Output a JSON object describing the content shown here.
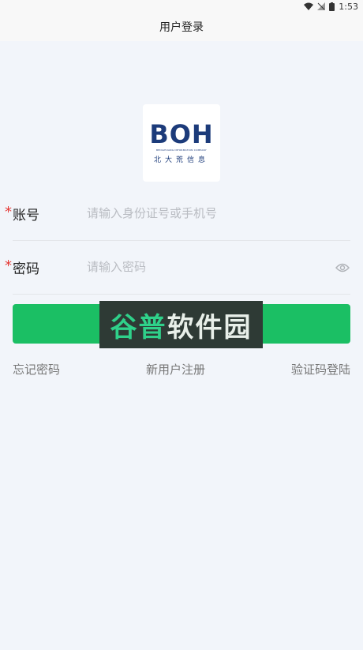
{
  "status_bar": {
    "time": "1:53",
    "icons": [
      "wifi-icon",
      "signal-icon",
      "battery-icon"
    ]
  },
  "header": {
    "title": "用户登录"
  },
  "logo": {
    "text": "BOH",
    "subtitle": "BEIDAHUANG INFORMATION COMPANY",
    "chinese": "北大荒信息"
  },
  "form": {
    "account": {
      "required_mark": "*",
      "label": "账号",
      "placeholder": "请输入身份证号或手机号",
      "value": ""
    },
    "password": {
      "required_mark": "*",
      "label": "密码",
      "placeholder": "请输入密码",
      "value": "",
      "toggle_icon": "eye-icon"
    },
    "login_label": ""
  },
  "watermark": {
    "part1": "谷普",
    "part2": "软件园"
  },
  "links": {
    "forgot_password": "忘记密码",
    "register": "新用户注册",
    "sms_login": "验证码登陆"
  },
  "colors": {
    "primary": "#1bbf64",
    "required": "#e53935",
    "background": "#f2f5fa",
    "logo": "#1c3b7a"
  }
}
